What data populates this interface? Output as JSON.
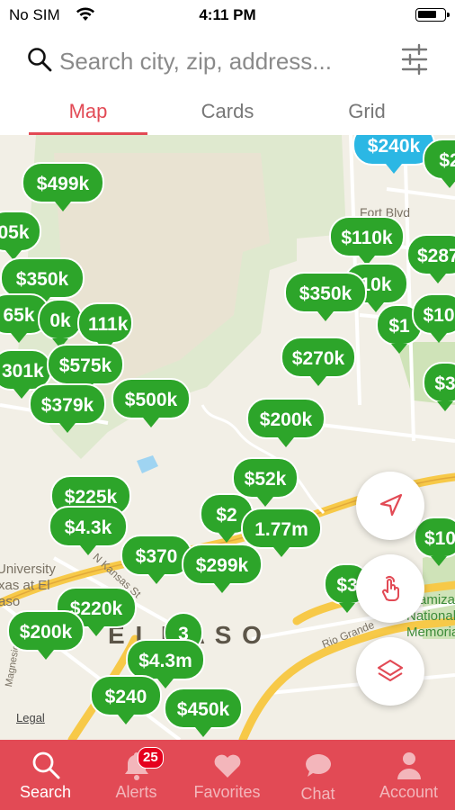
{
  "status_bar": {
    "carrier": "No SIM",
    "time": "4:11 PM"
  },
  "search": {
    "placeholder": "Search city, zip, address..."
  },
  "tabs": [
    {
      "label": "Map",
      "active": true
    },
    {
      "label": "Cards",
      "active": false
    },
    {
      "label": "Grid",
      "active": false
    }
  ],
  "map": {
    "labels": {
      "fort_blvd": "Fort Blvd",
      "university": "University",
      "texas_at_el": "xas at El",
      "paso": "aso",
      "kansas": "N Kansas St",
      "el_paso": "E L    P A S O",
      "rio_grande": "Rio Grande",
      "chamizal_1": "amiza",
      "chamizal_2": "National",
      "chamizal_3": "Memorial",
      "magnesio": "Magnesio",
      "legal": "Legal"
    },
    "pins": [
      {
        "price": "$240k",
        "color": "blue"
      },
      {
        "price": "$2"
      },
      {
        "price": "$499k"
      },
      {
        "price": "05k"
      },
      {
        "price": "$110k"
      },
      {
        "price": "$287"
      },
      {
        "price": "$350k"
      },
      {
        "price": "10k"
      },
      {
        "price": "$350k"
      },
      {
        "price": "65k"
      },
      {
        "price": "0k"
      },
      {
        "price": "111k"
      },
      {
        "price": "$1"
      },
      {
        "price": "$10"
      },
      {
        "price": "$270k"
      },
      {
        "price": "301k"
      },
      {
        "price": "$575k"
      },
      {
        "price": "$379k"
      },
      {
        "price": "$500k"
      },
      {
        "price": "$3"
      },
      {
        "price": "$200k"
      },
      {
        "price": "$52k"
      },
      {
        "price": "$225k"
      },
      {
        "price": "$4.3k"
      },
      {
        "price": "$2"
      },
      {
        "price": "1.77m"
      },
      {
        "price": "$10"
      },
      {
        "price": "$370"
      },
      {
        "price": "$299k"
      },
      {
        "price": "$3"
      },
      {
        "price": "$220k"
      },
      {
        "price": "$200k"
      },
      {
        "price": "3"
      },
      {
        "price": "$4.3m"
      },
      {
        "price": "$240"
      },
      {
        "price": "$450k"
      }
    ]
  },
  "controls": {
    "locate_icon": "navigation-arrow-icon",
    "draw_icon": "hand-touch-icon",
    "layers_icon": "layers-icon"
  },
  "tabbar": {
    "items": [
      {
        "label": "Search",
        "icon": "search-icon",
        "active": true
      },
      {
        "label": "Alerts",
        "icon": "bell-icon",
        "active": false,
        "badge": "25"
      },
      {
        "label": "Favorites",
        "icon": "heart-icon",
        "active": false
      },
      {
        "label": "Chat",
        "icon": "chat-icon",
        "active": false
      },
      {
        "label": "Account",
        "icon": "person-icon",
        "active": false
      }
    ]
  },
  "colors": {
    "accent": "#e24a55",
    "pin_green": "#2da52a",
    "pin_blue": "#2bb7e4",
    "map_bg": "#f2efe6",
    "road_yellow": "#f7c948"
  }
}
